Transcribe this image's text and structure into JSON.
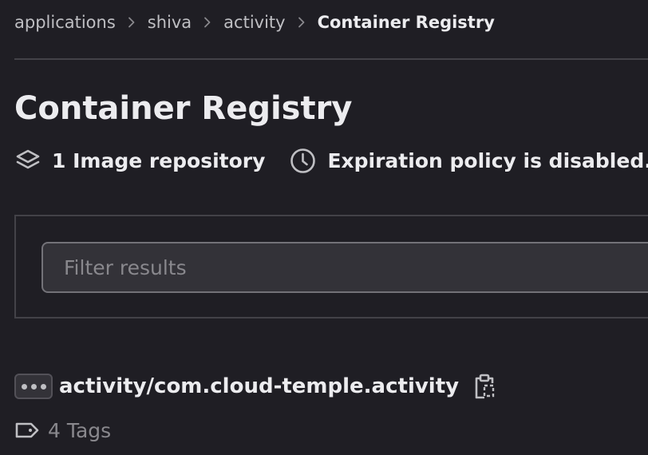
{
  "breadcrumb": {
    "items": [
      {
        "label": "applications"
      },
      {
        "label": "shiva"
      },
      {
        "label": "activity"
      },
      {
        "label": "Container Registry"
      }
    ],
    "separator_icon": "chevron-right-icon"
  },
  "header": {
    "title": "Container Registry"
  },
  "meta": {
    "repositories": {
      "icon": "layers-icon",
      "label": "1 Image repository"
    },
    "expiration": {
      "icon": "clock-icon",
      "label": "Expiration policy is disabled."
    }
  },
  "filter": {
    "placeholder": "Filter results",
    "value": ""
  },
  "repository": {
    "name": "activity/com.cloud-temple.activity",
    "more_icon": "ellipsis-icon",
    "copy_icon": "copy-to-clipboard-icon",
    "tags": {
      "icon": "label-icon",
      "label": "4 Tags"
    }
  },
  "colors": {
    "background": "#1f1e24",
    "text": "#ececef",
    "muted_text": "#89888d",
    "border": "#434248",
    "input_background": "#333238"
  }
}
